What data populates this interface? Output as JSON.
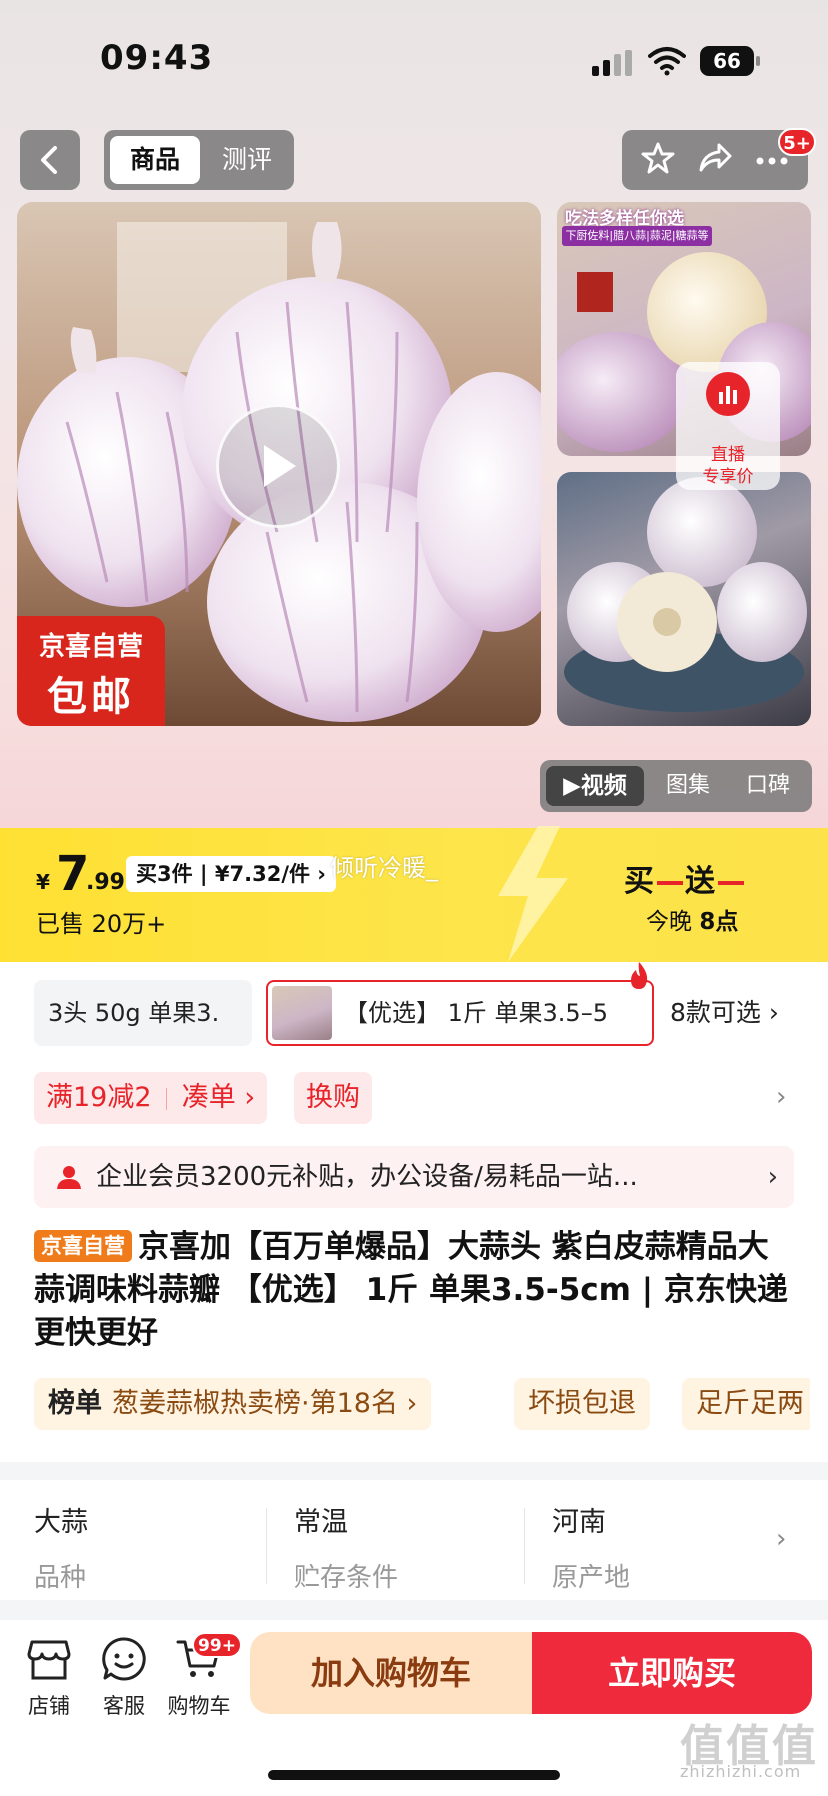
{
  "status_bar": {
    "time": "09:43",
    "battery": "66"
  },
  "nav": {
    "tabs": [
      "商品",
      "测评"
    ],
    "badge": "5+"
  },
  "gallery": {
    "promo_tag_line1": "京喜自营",
    "promo_tag_line2": "包邮",
    "thumb1_banner": "吃法多样任你选",
    "thumb1_banner_sub": "下厨佐料|腊八蒜|蒜泥|糖蒜等",
    "live_line1": "直播",
    "live_line2": "专享价",
    "media_tabs": [
      "▶视频",
      "图集",
      "口碑"
    ]
  },
  "price": {
    "currency": "¥",
    "int": "7",
    "dec": ".99",
    "bulk": "买3件 | ¥7.32/件 ›",
    "sold": "已售 20万+",
    "danmaku": "倾听冷暖_",
    "bogo_a": "买",
    "bogo_b": "送",
    "tonight_a": "今晚",
    "tonight_b": "8点"
  },
  "specs": {
    "option1": "3头 50g 单果3.",
    "option2": "【优选】 1斤 单果3.5–5",
    "more": "8款可选 ›"
  },
  "promos": {
    "discount": "满19减2",
    "make_up": "凑单 ›",
    "swap": "换购",
    "chevron": "›"
  },
  "member": {
    "text": "企业会员3200元补贴，办公设备/易耗品一站...",
    "chevron": "›"
  },
  "title": {
    "tag": "京喜自营",
    "text": "京喜加【百万单爆品】大蒜头 紫白皮蒜精品大蒜调味料蒜瓣 【优选】 1斤 单果3.5-5cm | 京东快递 更快更好"
  },
  "rank": {
    "label": "榜单",
    "value": "葱姜蒜椒热卖榜·第18名 ›",
    "chip2": "坏损包退",
    "chip3": "足斤足两"
  },
  "attributes": [
    {
      "value": "大蒜",
      "key": "品种"
    },
    {
      "value": "常温",
      "key": "贮存条件"
    },
    {
      "value": "河南",
      "key": "原产地"
    }
  ],
  "attributes_chevron": "›",
  "bottom_bar": {
    "shop": "店铺",
    "service": "客服",
    "cart": "购物车",
    "cart_badge": "99+",
    "add_to_cart": "加入购物车",
    "buy_now": "立即购买"
  },
  "watermark": {
    "main": "值值值",
    "sub": "zhizhizhi.com"
  },
  "colors": {
    "accent_red": "#e8242b",
    "price_bar_yellow": "#ffe033",
    "jx_orange": "#f07b1a"
  }
}
